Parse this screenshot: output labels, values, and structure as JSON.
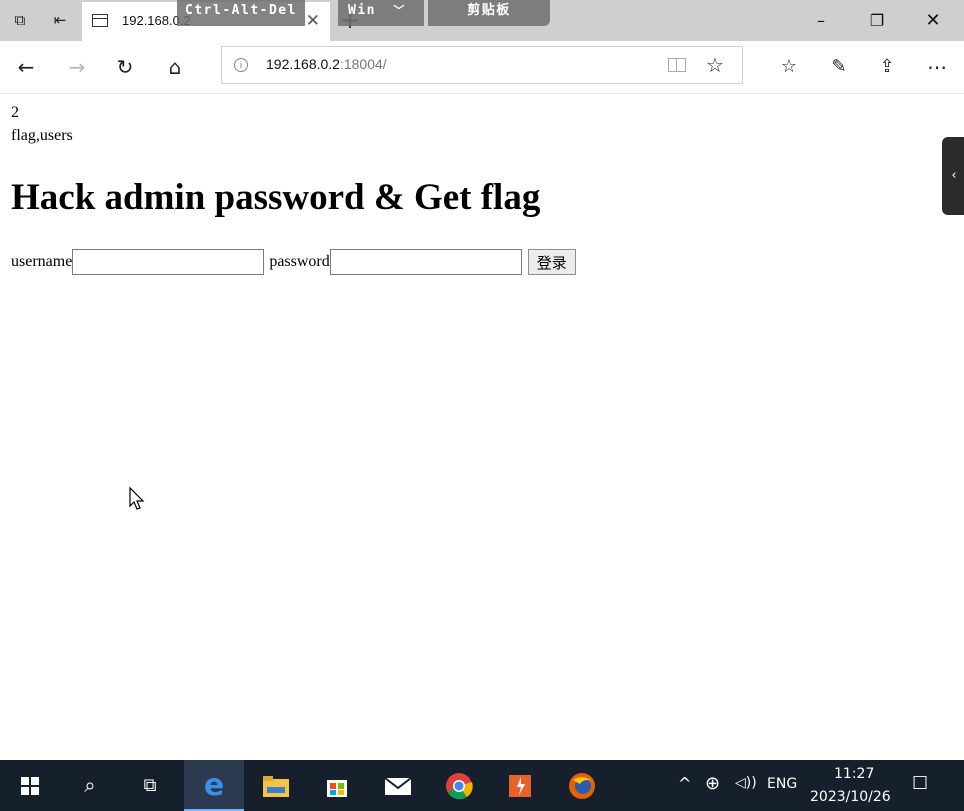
{
  "browser": {
    "tab_title": "192.168.0.2",
    "address": {
      "host": "192.168.0.2",
      "rest": ":18004/"
    }
  },
  "remote_toolbar": {
    "ctrl_alt_del": "Ctrl-Alt-Del",
    "win": "Win",
    "clipboard": "剪贴板"
  },
  "page": {
    "line1": "2",
    "line2": "flag,users",
    "heading": "Hack admin password & Get flag",
    "username_label": "username",
    "password_label": "password",
    "login_button": "登录"
  },
  "taskbar": {
    "language": "ENG",
    "time": "11:27",
    "date": "2023/10/26"
  },
  "icons": [
    "tabs-aside-icon",
    "back-tabs-icon",
    "page-icon",
    "close-icon",
    "new-tab-icon",
    "minimize-icon",
    "restore-icon",
    "back-arrow-icon",
    "forward-arrow-icon",
    "refresh-icon",
    "home-icon",
    "info-icon",
    "reading-view-icon",
    "favorite-star-icon",
    "favorites-list-icon",
    "pen-icon",
    "share-icon",
    "more-icon",
    "windows-start-icon",
    "search-icon",
    "task-view-icon",
    "edge-icon",
    "file-explorer-icon",
    "store-icon",
    "mail-icon",
    "chrome-icon",
    "app-icon",
    "firefox-icon",
    "chevron-up-icon",
    "network-icon",
    "volume-icon",
    "notification-icon"
  ]
}
